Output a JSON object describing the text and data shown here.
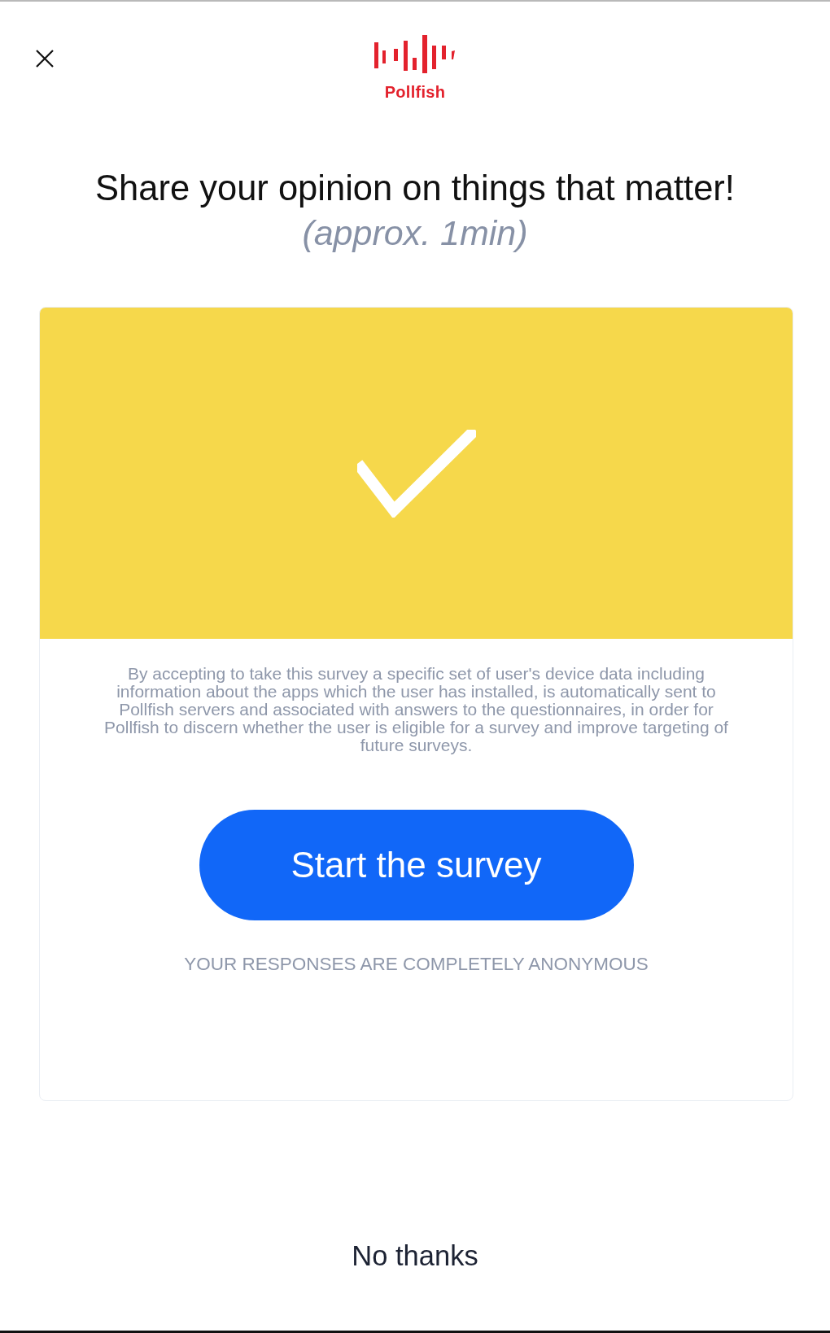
{
  "header": {
    "brand": "Pollfish"
  },
  "title": "Share your opinion on things that matter!",
  "subtitle": "(approx. 1min)",
  "card": {
    "disclaimer": "By accepting to take this survey a specific set of user's device data including information about the apps which the user has installed, is automatically sent to Pollfish servers and associated with answers to the questionnaires, in order for Pollfish to discern whether the user is eligible for a survey and improve targeting of future surveys.",
    "start_button": "Start the survey",
    "anonymity_note": "YOUR RESPONSES ARE COMPLETELY ANONYMOUS"
  },
  "dismiss_link": "No thanks"
}
